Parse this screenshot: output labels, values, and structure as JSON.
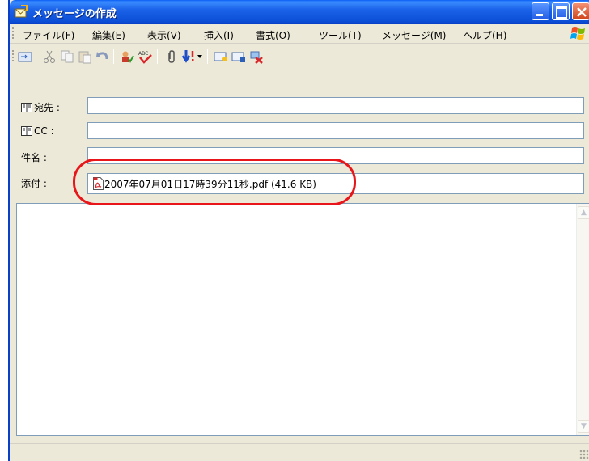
{
  "window": {
    "title": "メッセージの作成"
  },
  "menubar": {
    "items": [
      {
        "label": "ファイル(F)"
      },
      {
        "label": "編集(E)"
      },
      {
        "label": "表示(V)"
      },
      {
        "label": "挿入(I)"
      },
      {
        "label": "書式(O)"
      },
      {
        "label": "ツール(T)"
      },
      {
        "label": "メッセージ(M)"
      },
      {
        "label": "ヘルプ(H)"
      }
    ]
  },
  "toolbar": {
    "icons": [
      "send-icon",
      "cut-icon",
      "copy-icon",
      "paste-icon",
      "undo-icon",
      "check-names-icon",
      "spelling-icon",
      "attach-icon",
      "priority-icon",
      "sign-icon",
      "encrypt-icon",
      "work-offline-icon"
    ]
  },
  "fields": {
    "to_label": "宛先 :",
    "to_value": "",
    "cc_label": "CC :",
    "cc_value": "",
    "subject_label": "件名 :",
    "subject_value": "",
    "attach_label": "添付 :",
    "attachment": "2007年07月01日17時39分11秒.pdf (41.6 KB)"
  },
  "colors": {
    "highlight": "#e8161b",
    "titlebar": "#0b4fd6"
  }
}
